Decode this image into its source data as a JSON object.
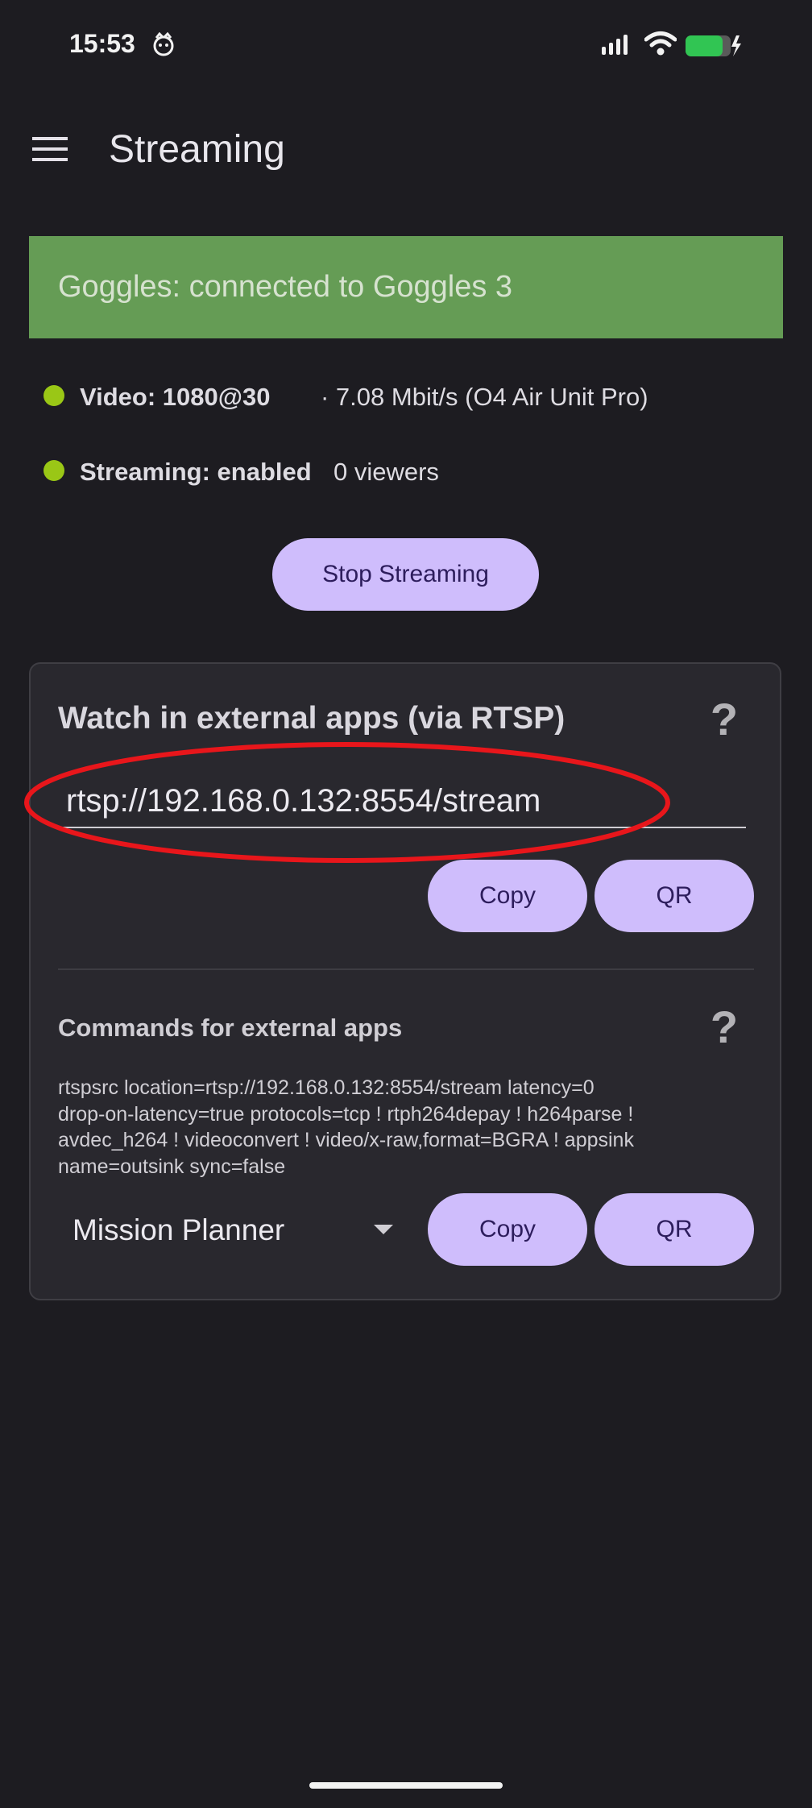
{
  "status_bar": {
    "time": "15:53",
    "icons": [
      "notification-app-icon",
      "signal-icon",
      "wifi-icon",
      "battery-charging-icon"
    ]
  },
  "app_bar": {
    "title": "Streaming",
    "menu_icon": "hamburger-menu-icon"
  },
  "banner": {
    "text": "Goggles: connected to Goggles 3",
    "color": "#659c55"
  },
  "status_rows": [
    {
      "label": "Video: 1080@30",
      "value": "· 7.08 Mbit/s (O4 Air Unit Pro)",
      "indicator_color": "#9ac716"
    },
    {
      "label": "Streaming: enabled",
      "value": "0 viewers",
      "indicator_color": "#9ac716"
    }
  ],
  "stop_button": {
    "label": "Stop Streaming"
  },
  "rtsp_card": {
    "title": "Watch in external apps (via RTSP)",
    "help": "?",
    "url": "rtsp://192.168.0.132:8554/stream",
    "copy_label": "Copy",
    "qr_label": "QR",
    "annotation_color": "#e8161b"
  },
  "commands": {
    "title": "Commands for external apps",
    "help": "?",
    "lines": [
      "rtspsrc location=rtsp://192.168.0.132:8554/stream latency=0",
      "drop-on-latency=true protocols=tcp ! rtph264depay ! h264parse !",
      "avdec_h264 ! videoconvert ! video/x-raw,format=BGRA ! appsink",
      "name=outsink sync=false"
    ],
    "selected_app": "Mission Planner",
    "copy_label": "Copy",
    "qr_label": "QR"
  },
  "theme": {
    "background": "#1d1c21",
    "accent": "#cfbdfc",
    "accent_text": "#2d1d5c"
  }
}
